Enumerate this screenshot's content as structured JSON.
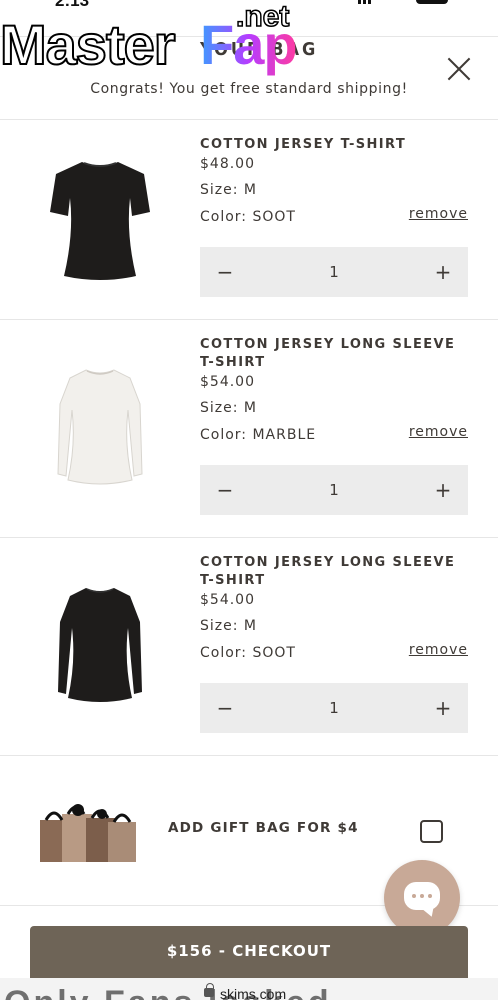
{
  "status_bar": {
    "time": "2:13"
  },
  "watermark": {
    "brand": "MasterFap",
    "master": "Master",
    "fap": "Fap",
    "net": ".net"
  },
  "header": {
    "title": "YOUR BAG",
    "shipping_message": "Congrats! You get free standard shipping!"
  },
  "cart": {
    "items": [
      {
        "name": "COTTON JERSEY T-SHIRT",
        "price": "$48.00",
        "size": "Size: M",
        "color": "Color: SOOT",
        "remove_label": "remove",
        "quantity": "1",
        "minus": "−",
        "plus": "+",
        "image": "black-tshirt-image",
        "garment_color": "#1e1c1b"
      },
      {
        "name": "COTTON JERSEY LONG SLEEVE T-SHIRT",
        "price": "$54.00",
        "size": "Size: M",
        "color": "Color: MARBLE",
        "remove_label": "remove",
        "quantity": "1",
        "minus": "−",
        "plus": "+",
        "image": "white-long-sleeve-image",
        "garment_color": "#f2f0ec"
      },
      {
        "name": "COTTON JERSEY LONG SLEEVE T-SHIRT",
        "price": "$54.00",
        "size": "Size: M",
        "color": "Color: SOOT",
        "remove_label": "remove",
        "quantity": "1",
        "minus": "−",
        "plus": "+",
        "image": "black-long-sleeve-image",
        "garment_color": "#1e1c1b"
      }
    ]
  },
  "gift_bag": {
    "label": "ADD GIFT BAG FOR $4",
    "checked": false
  },
  "chat": {
    "icon": "chat-icon"
  },
  "checkout": {
    "label": "$156 - CHECKOUT"
  },
  "browser": {
    "url": "skims.com",
    "background_text": "Only Fans leaked"
  },
  "colors": {
    "checkout_bg": "#6e6457",
    "chat_bg": "#c8a997",
    "stepper_bg": "#ececec",
    "text": "#3f3a36"
  }
}
